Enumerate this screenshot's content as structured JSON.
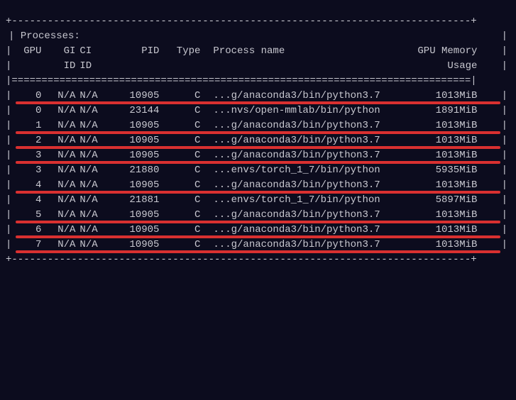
{
  "title": "Processes:",
  "headers": {
    "gpu": "GPU",
    "gi": "GI",
    "ci": "CI",
    "pid": "PID",
    "type": "Type",
    "name": "Process name",
    "mem": "GPU Memory",
    "gi_sub": "ID",
    "ci_sub": "ID",
    "mem_sub": "Usage"
  },
  "rows": [
    {
      "gpu": "0",
      "gi": "N/A",
      "ci": "N/A",
      "pid": "10905",
      "type": "C",
      "name": "...g/anaconda3/bin/python3.7",
      "mem": "1013MiB",
      "highlighted": true
    },
    {
      "gpu": "0",
      "gi": "N/A",
      "ci": "N/A",
      "pid": "23144",
      "type": "C",
      "name": "...nvs/open-mmlab/bin/python",
      "mem": "1891MiB",
      "highlighted": false
    },
    {
      "gpu": "1",
      "gi": "N/A",
      "ci": "N/A",
      "pid": "10905",
      "type": "C",
      "name": "...g/anaconda3/bin/python3.7",
      "mem": "1013MiB",
      "highlighted": true
    },
    {
      "gpu": "2",
      "gi": "N/A",
      "ci": "N/A",
      "pid": "10905",
      "type": "C",
      "name": "...g/anaconda3/bin/python3.7",
      "mem": "1013MiB",
      "highlighted": true
    },
    {
      "gpu": "3",
      "gi": "N/A",
      "ci": "N/A",
      "pid": "10905",
      "type": "C",
      "name": "...g/anaconda3/bin/python3.7",
      "mem": "1013MiB",
      "highlighted": true
    },
    {
      "gpu": "3",
      "gi": "N/A",
      "ci": "N/A",
      "pid": "21880",
      "type": "C",
      "name": "...envs/torch_1_7/bin/python",
      "mem": "5935MiB",
      "highlighted": false
    },
    {
      "gpu": "4",
      "gi": "N/A",
      "ci": "N/A",
      "pid": "10905",
      "type": "C",
      "name": "...g/anaconda3/bin/python3.7",
      "mem": "1013MiB",
      "highlighted": true
    },
    {
      "gpu": "4",
      "gi": "N/A",
      "ci": "N/A",
      "pid": "21881",
      "type": "C",
      "name": "...envs/torch_1_7/bin/python",
      "mem": "5897MiB",
      "highlighted": false
    },
    {
      "gpu": "5",
      "gi": "N/A",
      "ci": "N/A",
      "pid": "10905",
      "type": "C",
      "name": "...g/anaconda3/bin/python3.7",
      "mem": "1013MiB",
      "highlighted": true
    },
    {
      "gpu": "6",
      "gi": "N/A",
      "ci": "N/A",
      "pid": "10905",
      "type": "C",
      "name": "...g/anaconda3/bin/python3.7",
      "mem": "1013MiB",
      "highlighted": true
    },
    {
      "gpu": "7",
      "gi": "N/A",
      "ci": "N/A",
      "pid": "10905",
      "type": "C",
      "name": "...g/anaconda3/bin/python3.7",
      "mem": "1013MiB",
      "highlighted": true
    }
  ],
  "dividers": {
    "dashed": "+-----------------------------------------------------------------------------+",
    "heavy": "|=============================================================================|"
  }
}
